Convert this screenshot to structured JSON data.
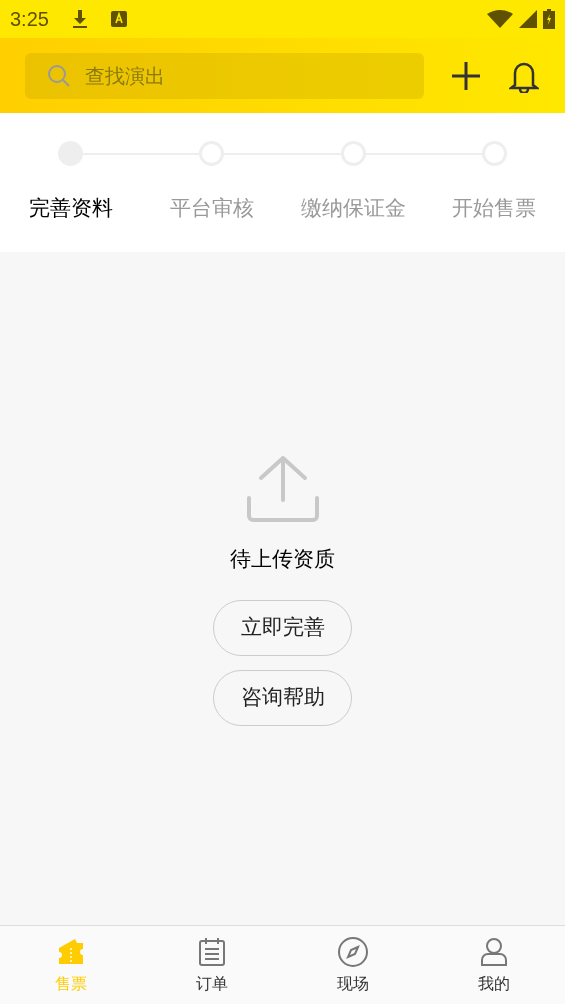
{
  "status_bar": {
    "time": "3:25"
  },
  "header": {
    "search": {
      "placeholder": "查找演出"
    }
  },
  "steps": [
    {
      "label": "完善资料",
      "selected": true
    },
    {
      "label": "平台审核",
      "selected": false
    },
    {
      "label": "缴纳保证金",
      "selected": false
    },
    {
      "label": "开始售票",
      "selected": false
    }
  ],
  "empty_state": {
    "message": "待上传资质",
    "buttons": [
      "立即完善",
      "咨询帮助"
    ]
  },
  "bottom_nav": [
    {
      "label": "售票",
      "kind": "ticket",
      "selected": true
    },
    {
      "label": "订单",
      "kind": "list",
      "selected": false
    },
    {
      "label": "现场",
      "kind": "compass",
      "selected": false
    },
    {
      "label": "我的",
      "kind": "user",
      "selected": false
    }
  ]
}
